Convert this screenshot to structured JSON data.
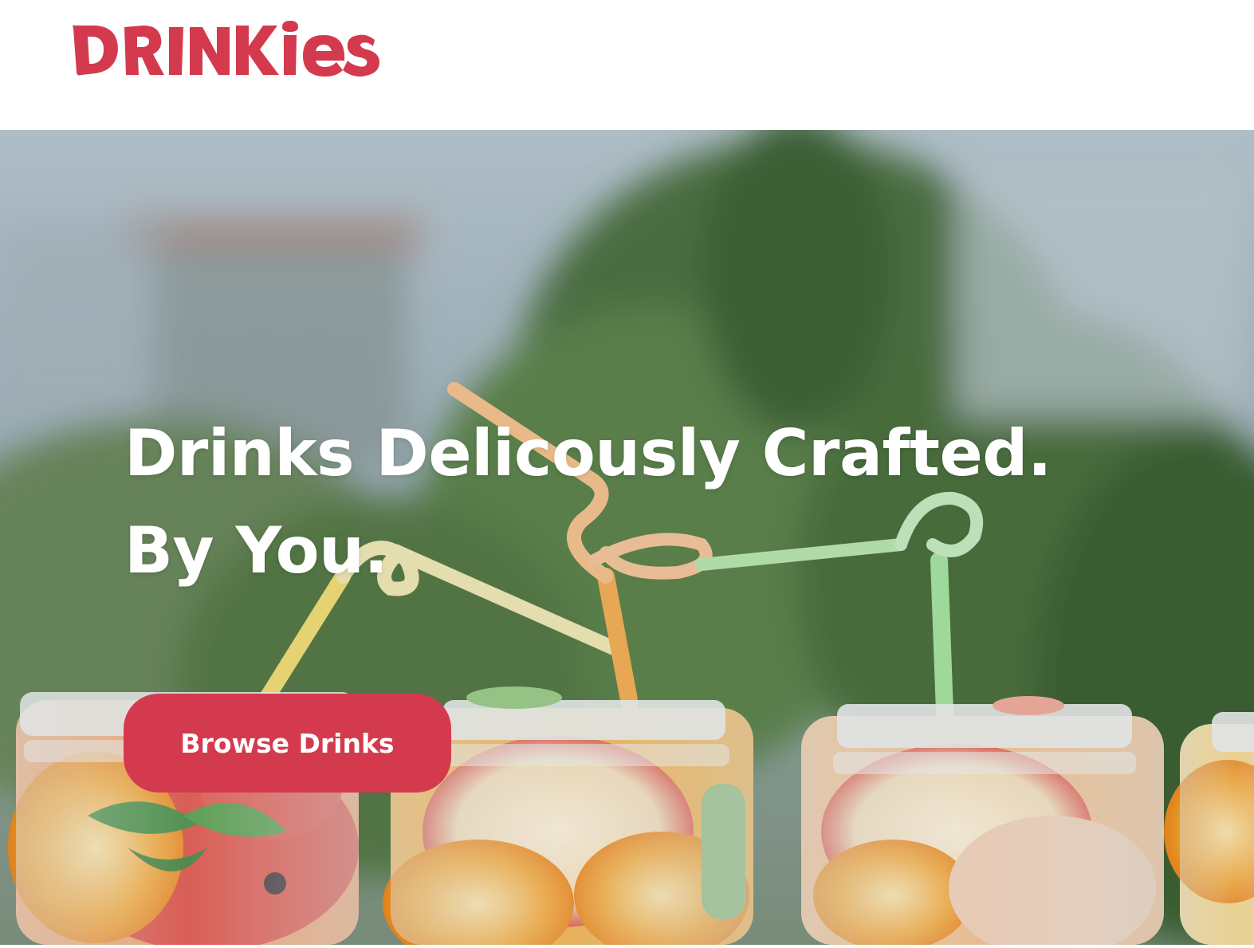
{
  "brand": {
    "logo_text": "DRINKIES",
    "color": "#d43a4e"
  },
  "hero": {
    "headline_line1": "Drinks Delicously Crafted.",
    "headline_line2": "By You.",
    "cta_label": "Browse Drinks",
    "image_description_icon": "drink-jars-photo"
  },
  "colors": {
    "accent": "#d43a4e",
    "text_on_hero": "#ffffff",
    "background": "#ffffff"
  }
}
